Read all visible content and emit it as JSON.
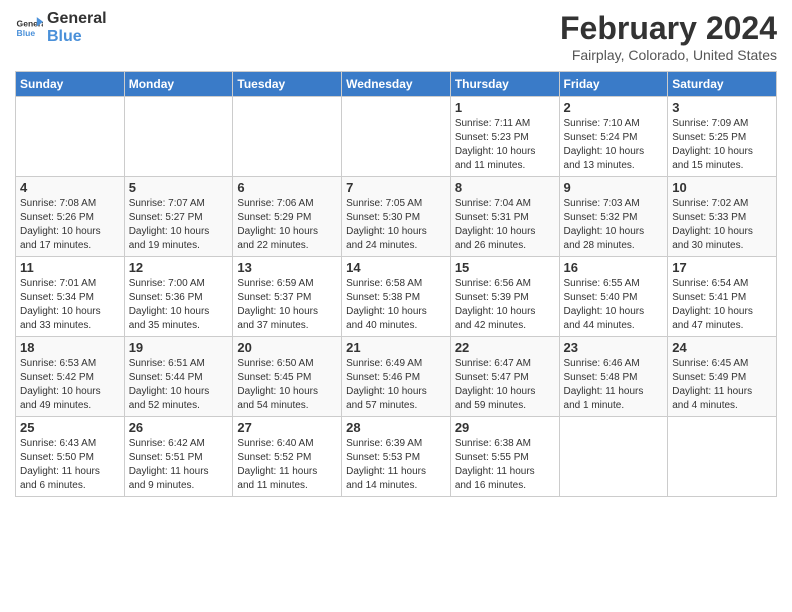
{
  "header": {
    "logo_line1": "General",
    "logo_line2": "Blue",
    "month_title": "February 2024",
    "location": "Fairplay, Colorado, United States"
  },
  "days_of_week": [
    "Sunday",
    "Monday",
    "Tuesday",
    "Wednesday",
    "Thursday",
    "Friday",
    "Saturday"
  ],
  "weeks": [
    [
      {
        "day": "",
        "info": ""
      },
      {
        "day": "",
        "info": ""
      },
      {
        "day": "",
        "info": ""
      },
      {
        "day": "",
        "info": ""
      },
      {
        "day": "1",
        "info": "Sunrise: 7:11 AM\nSunset: 5:23 PM\nDaylight: 10 hours\nand 11 minutes."
      },
      {
        "day": "2",
        "info": "Sunrise: 7:10 AM\nSunset: 5:24 PM\nDaylight: 10 hours\nand 13 minutes."
      },
      {
        "day": "3",
        "info": "Sunrise: 7:09 AM\nSunset: 5:25 PM\nDaylight: 10 hours\nand 15 minutes."
      }
    ],
    [
      {
        "day": "4",
        "info": "Sunrise: 7:08 AM\nSunset: 5:26 PM\nDaylight: 10 hours\nand 17 minutes."
      },
      {
        "day": "5",
        "info": "Sunrise: 7:07 AM\nSunset: 5:27 PM\nDaylight: 10 hours\nand 19 minutes."
      },
      {
        "day": "6",
        "info": "Sunrise: 7:06 AM\nSunset: 5:29 PM\nDaylight: 10 hours\nand 22 minutes."
      },
      {
        "day": "7",
        "info": "Sunrise: 7:05 AM\nSunset: 5:30 PM\nDaylight: 10 hours\nand 24 minutes."
      },
      {
        "day": "8",
        "info": "Sunrise: 7:04 AM\nSunset: 5:31 PM\nDaylight: 10 hours\nand 26 minutes."
      },
      {
        "day": "9",
        "info": "Sunrise: 7:03 AM\nSunset: 5:32 PM\nDaylight: 10 hours\nand 28 minutes."
      },
      {
        "day": "10",
        "info": "Sunrise: 7:02 AM\nSunset: 5:33 PM\nDaylight: 10 hours\nand 30 minutes."
      }
    ],
    [
      {
        "day": "11",
        "info": "Sunrise: 7:01 AM\nSunset: 5:34 PM\nDaylight: 10 hours\nand 33 minutes."
      },
      {
        "day": "12",
        "info": "Sunrise: 7:00 AM\nSunset: 5:36 PM\nDaylight: 10 hours\nand 35 minutes."
      },
      {
        "day": "13",
        "info": "Sunrise: 6:59 AM\nSunset: 5:37 PM\nDaylight: 10 hours\nand 37 minutes."
      },
      {
        "day": "14",
        "info": "Sunrise: 6:58 AM\nSunset: 5:38 PM\nDaylight: 10 hours\nand 40 minutes."
      },
      {
        "day": "15",
        "info": "Sunrise: 6:56 AM\nSunset: 5:39 PM\nDaylight: 10 hours\nand 42 minutes."
      },
      {
        "day": "16",
        "info": "Sunrise: 6:55 AM\nSunset: 5:40 PM\nDaylight: 10 hours\nand 44 minutes."
      },
      {
        "day": "17",
        "info": "Sunrise: 6:54 AM\nSunset: 5:41 PM\nDaylight: 10 hours\nand 47 minutes."
      }
    ],
    [
      {
        "day": "18",
        "info": "Sunrise: 6:53 AM\nSunset: 5:42 PM\nDaylight: 10 hours\nand 49 minutes."
      },
      {
        "day": "19",
        "info": "Sunrise: 6:51 AM\nSunset: 5:44 PM\nDaylight: 10 hours\nand 52 minutes."
      },
      {
        "day": "20",
        "info": "Sunrise: 6:50 AM\nSunset: 5:45 PM\nDaylight: 10 hours\nand 54 minutes."
      },
      {
        "day": "21",
        "info": "Sunrise: 6:49 AM\nSunset: 5:46 PM\nDaylight: 10 hours\nand 57 minutes."
      },
      {
        "day": "22",
        "info": "Sunrise: 6:47 AM\nSunset: 5:47 PM\nDaylight: 10 hours\nand 59 minutes."
      },
      {
        "day": "23",
        "info": "Sunrise: 6:46 AM\nSunset: 5:48 PM\nDaylight: 11 hours\nand 1 minute."
      },
      {
        "day": "24",
        "info": "Sunrise: 6:45 AM\nSunset: 5:49 PM\nDaylight: 11 hours\nand 4 minutes."
      }
    ],
    [
      {
        "day": "25",
        "info": "Sunrise: 6:43 AM\nSunset: 5:50 PM\nDaylight: 11 hours\nand 6 minutes."
      },
      {
        "day": "26",
        "info": "Sunrise: 6:42 AM\nSunset: 5:51 PM\nDaylight: 11 hours\nand 9 minutes."
      },
      {
        "day": "27",
        "info": "Sunrise: 6:40 AM\nSunset: 5:52 PM\nDaylight: 11 hours\nand 11 minutes."
      },
      {
        "day": "28",
        "info": "Sunrise: 6:39 AM\nSunset: 5:53 PM\nDaylight: 11 hours\nand 14 minutes."
      },
      {
        "day": "29",
        "info": "Sunrise: 6:38 AM\nSunset: 5:55 PM\nDaylight: 11 hours\nand 16 minutes."
      },
      {
        "day": "",
        "info": ""
      },
      {
        "day": "",
        "info": ""
      }
    ]
  ]
}
